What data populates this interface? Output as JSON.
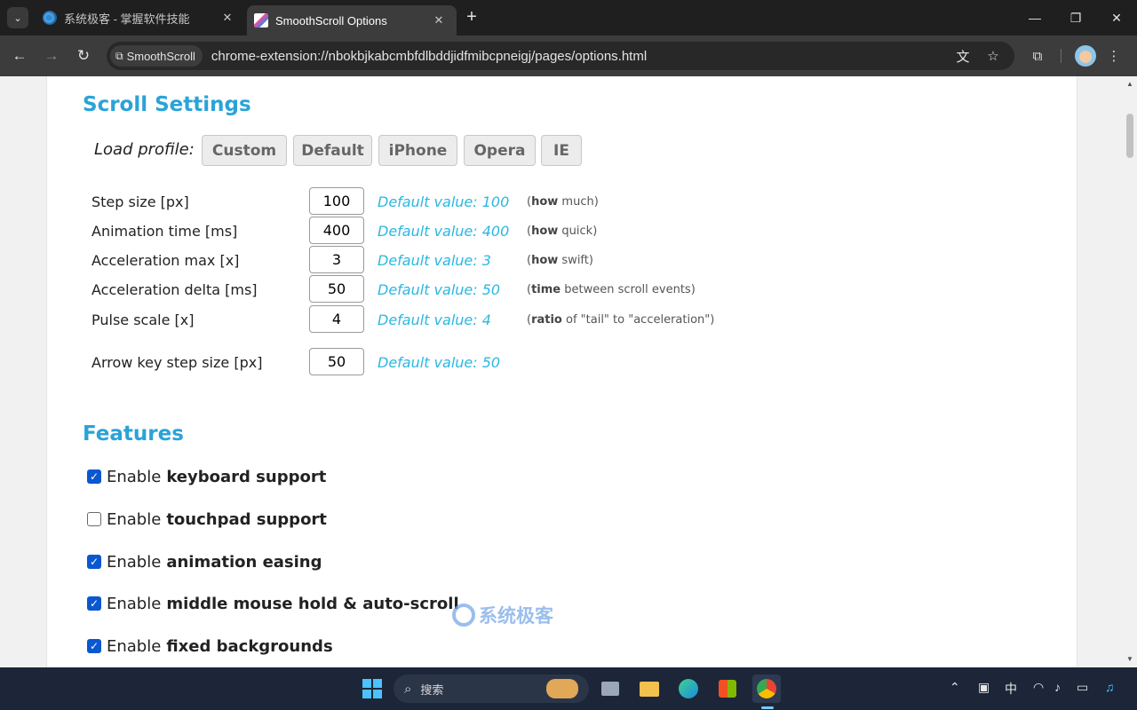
{
  "browser": {
    "tabs": [
      {
        "title": "系统极客 - 掌握软件技能",
        "active": false
      },
      {
        "title": "SmoothScroll Options",
        "active": true
      }
    ],
    "new_tab_label": "+",
    "window_controls": {
      "minimize": "—",
      "restore": "❐",
      "close": "✕"
    },
    "chip_label": "SmoothScroll",
    "url": "chrome-extension://nbokbjkabcmbfdlbddjidfmibcpneigj/pages/options.html"
  },
  "page": {
    "scroll_title": "Scroll Settings",
    "profile_label": "Load profile:",
    "profiles": [
      "Custom",
      "Default",
      "iPhone",
      "Opera",
      "IE"
    ],
    "settings": [
      {
        "label": "Step size [px]",
        "value": "100",
        "default": "Default value: 100",
        "hint_bold": "how",
        "hint_rest": " much)"
      },
      {
        "label": "Animation time [ms]",
        "value": "400",
        "default": "Default value: 400",
        "hint_bold": "how",
        "hint_rest": " quick)"
      },
      {
        "label": "Acceleration max [x]",
        "value": "3",
        "default": "Default value: 3",
        "hint_bold": "how",
        "hint_rest": " swift)"
      },
      {
        "label": "Acceleration delta [ms]",
        "value": "50",
        "default": "Default value: 50",
        "hint_bold": "time",
        "hint_rest": " between scroll events)"
      },
      {
        "label": "Pulse scale [x]",
        "value": "4",
        "default": "Default value: 4",
        "hint_bold": "ratio",
        "hint_rest": " of \"tail\" to \"acceleration\")"
      },
      {
        "label": "Arrow key step size [px]",
        "value": "50",
        "default": "Default value: 50"
      }
    ],
    "hint_open": "(",
    "features_title": "Features",
    "feature_prefix": "Enable",
    "features": [
      {
        "name": "keyboard support",
        "checked": true
      },
      {
        "name": "touchpad support",
        "checked": false
      },
      {
        "name": "animation easing",
        "checked": true
      },
      {
        "name": "middle mouse hold & auto-scroll",
        "checked": true
      },
      {
        "name": "fixed backgrounds",
        "checked": true
      }
    ],
    "watermark": "系统极客"
  },
  "taskbar": {
    "search_placeholder": "搜索",
    "ime": "中"
  },
  "colors": {
    "heading": "#2aa3d8",
    "default_value": "#2bb7e0",
    "checkbox": "#0b57d0"
  }
}
